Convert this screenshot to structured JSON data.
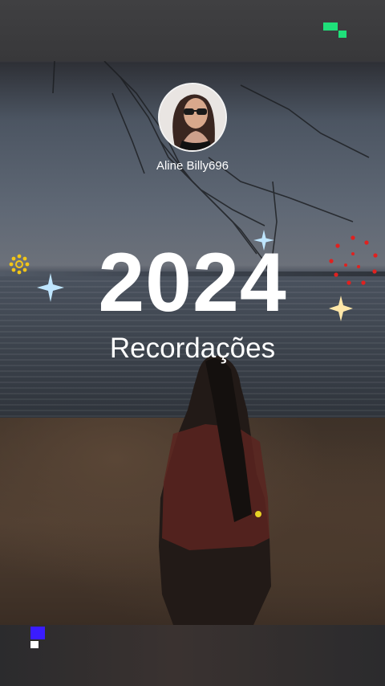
{
  "profile": {
    "username": "Aline Billy696"
  },
  "headline": {
    "year": "2024",
    "subtitle": "Recordações"
  },
  "colors": {
    "text": "#ffffff",
    "sparkle": "#bfe6ff",
    "sun_gold": "#f2c617",
    "dots_red": "#e0211f",
    "pixel_green": "#1fe07a",
    "pixel_blue": "#3a1cff"
  }
}
